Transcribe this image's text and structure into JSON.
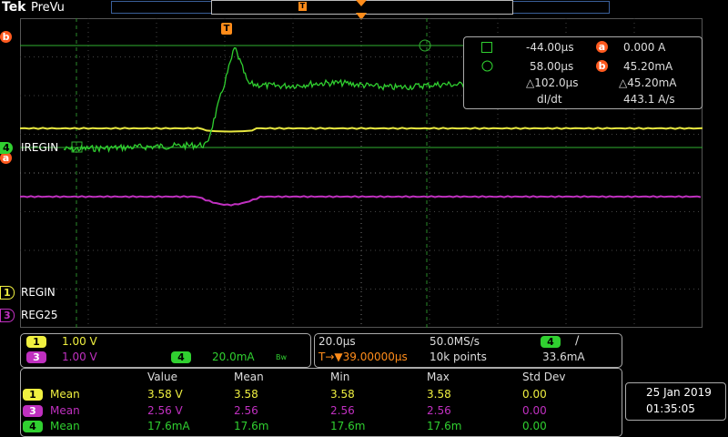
{
  "header": {
    "brand": "Tek",
    "mode": "PreVu"
  },
  "colors": {
    "ch1": "#f0f040",
    "ch3": "#c030c0",
    "ch4": "#30d030",
    "cursor": "#ff5a1f"
  },
  "markers": {
    "trigger": "T",
    "cursor_a": "a",
    "cursor_b": "b",
    "ch4_num": "4",
    "ch4_label": "IREGIN",
    "ch1_num": "1",
    "ch1_label": "REGIN",
    "ch3_num": "3",
    "ch3_label": "REG25"
  },
  "cursor_readout": {
    "a_time": "-44.00µs",
    "a_label": "a",
    "a_value": "0.000 A",
    "b_time": "58.00µs",
    "b_label": "b",
    "b_value": "45.20mA",
    "delta_time": "△102.0µs",
    "delta_value": "△45.20mA",
    "slope_label": "dI/dt",
    "slope_value": "443.1 A/s"
  },
  "vertical": {
    "ch1_num": "1",
    "ch1_scale": "1.00 V",
    "ch3_num": "3",
    "ch3_scale": "1.00 V",
    "ch4_num": "4",
    "ch4_scale": "20.0mA",
    "bw": "Bw"
  },
  "horizontal": {
    "timebase": "20.0µs",
    "sample_rate": "50.0MS/s",
    "trig_pos": "T→▼39.00000µs",
    "record": "10k points",
    "trig_source": "4",
    "trig_slope": "∕",
    "trig_level": "33.6mA"
  },
  "measurements": {
    "headers": [
      "Value",
      "Mean",
      "Min",
      "Max",
      "Std Dev"
    ],
    "rows": [
      {
        "ch": "1",
        "name": "Mean",
        "cells": [
          "3.58 V",
          "3.58",
          "3.58",
          "3.58",
          "0.00"
        ]
      },
      {
        "ch": "3",
        "name": "Mean",
        "cells": [
          "2.56 V",
          "2.56",
          "2.56",
          "2.56",
          "0.00"
        ]
      },
      {
        "ch": "4",
        "name": "Mean",
        "cells": [
          "17.6mA",
          "17.6m",
          "17.6m",
          "17.6m",
          "0.00"
        ]
      }
    ]
  },
  "datetime": {
    "date": "25 Jan  2019",
    "time": "01:35:05"
  }
}
